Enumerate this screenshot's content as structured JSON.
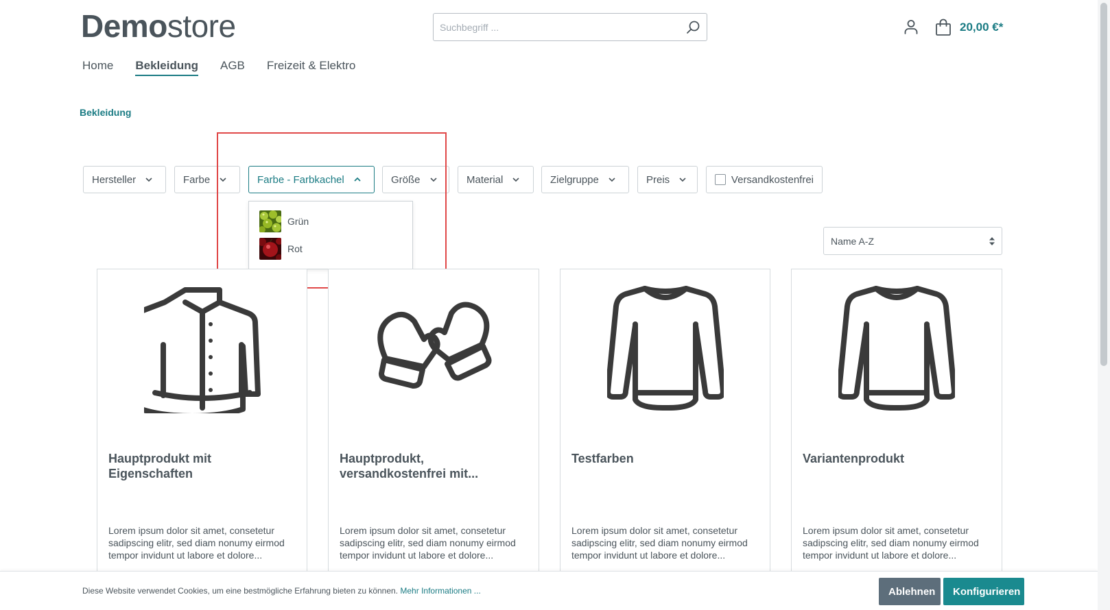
{
  "header": {
    "logo_bold": "Demo",
    "logo_light": "store",
    "search_placeholder": "Suchbegriff ...",
    "cart_total": "20,00 €*"
  },
  "nav": {
    "items": [
      {
        "label": "Home",
        "active": false
      },
      {
        "label": "Bekleidung",
        "active": true
      },
      {
        "label": "AGB",
        "active": false
      },
      {
        "label": "Freizeit & Elektro",
        "active": false
      }
    ]
  },
  "breadcrumb": "Bekleidung",
  "filters": [
    {
      "label": "Hersteller"
    },
    {
      "label": "Farbe"
    },
    {
      "label": "Farbe - Farbkachel",
      "open": true
    },
    {
      "label": "Größe"
    },
    {
      "label": "Material"
    },
    {
      "label": "Zielgruppe"
    },
    {
      "label": "Preis"
    },
    {
      "label": "Versandkostenfrei",
      "checkbox": true,
      "checked": false
    }
  ],
  "dropdown": {
    "options": [
      {
        "label": "Grün",
        "swatch_color": "#8fb81e"
      },
      {
        "label": "Rot",
        "swatch_color": "#9e1216"
      }
    ]
  },
  "sort": {
    "selected": "Name A-Z"
  },
  "products": [
    {
      "title": "Hauptprodukt mit Eigenschaften",
      "icon": "jacket-icon",
      "description": "Lorem ipsum dolor sit amet, consetetur sadipscing elitr, sed diam nonumy eirmod tempor invidunt ut labore et dolore..."
    },
    {
      "title": "Hauptprodukt, versandkostenfrei mit...",
      "icon": "mittens-icon",
      "description": "Lorem ipsum dolor sit amet, consetetur sadipscing elitr, sed diam nonumy eirmod tempor invidunt ut labore et dolore..."
    },
    {
      "title": "Testfarben",
      "icon": "sweater-icon",
      "description": "Lorem ipsum dolor sit amet, consetetur sadipscing elitr, sed diam nonumy eirmod tempor invidunt ut labore et dolore..."
    },
    {
      "title": "Variantenprodukt",
      "icon": "sweater-icon",
      "description": "Lorem ipsum dolor sit amet, consetetur sadipscing elitr, sed diam nonumy eirmod tempor invidunt ut labore et dolore..."
    }
  ],
  "cookie": {
    "text": "Diese Website verwendet Cookies, um eine bestmögliche Erfahrung bieten zu können.",
    "link": "Mehr Informationen ...",
    "decline": "Ablehnen",
    "configure": "Konfigurieren"
  },
  "colors": {
    "accent": "#1a7b83",
    "highlight": "#e04848",
    "decline_button": "#5d6e7b",
    "configure_button": "#1a8a8f"
  }
}
